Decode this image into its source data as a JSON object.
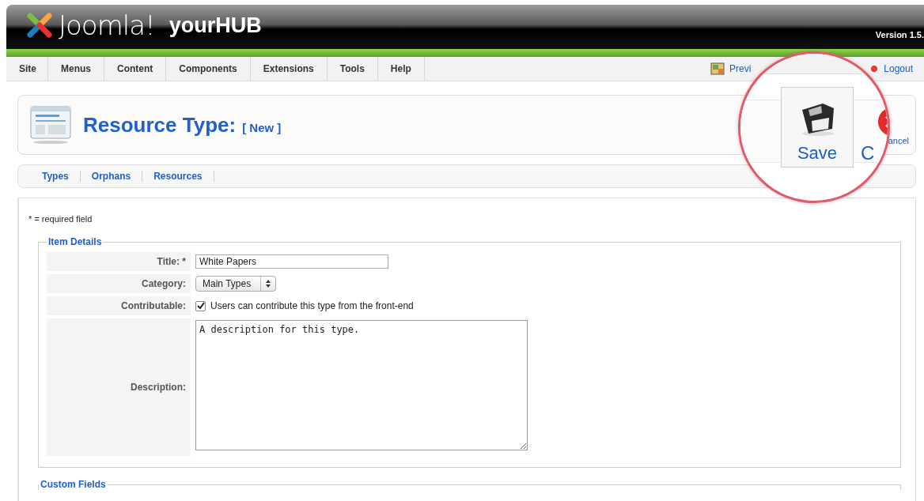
{
  "header": {
    "brand": "Joomla!",
    "site_name": "yourHUB",
    "version": "Version 1.5."
  },
  "menu": [
    {
      "label": "Site"
    },
    {
      "label": "Menus"
    },
    {
      "label": "Content"
    },
    {
      "label": "Components"
    },
    {
      "label": "Extensions"
    },
    {
      "label": "Tools"
    },
    {
      "label": "Help"
    }
  ],
  "header_links": [
    {
      "kind": "preview",
      "label": "Previ"
    },
    {
      "kind": "logout",
      "label": "Logout"
    }
  ],
  "toolbar": {
    "title": "Resource Type:",
    "subtitle": "[ New ]",
    "cancel_label": "ancel"
  },
  "magnifier": {
    "save_label": "Save",
    "cancel_label": "C"
  },
  "submenu": [
    {
      "label": "Types"
    },
    {
      "label": "Orphans"
    },
    {
      "label": "Resources"
    }
  ],
  "form": {
    "required_note": "* = required field",
    "fieldsets": [
      {
        "legend": "Item Details",
        "rows": [
          {
            "kind": "text",
            "label": "Title: *",
            "value": "White Papers"
          },
          {
            "kind": "select",
            "label": "Category:",
            "value": "Main Types"
          },
          {
            "kind": "checkbox",
            "label": "Contributable:",
            "checked": true,
            "text": "Users can contribute this type from the front-end"
          },
          {
            "kind": "textarea",
            "label": "Description:",
            "value": "A description for this type."
          }
        ]
      },
      {
        "legend": "Custom Fields"
      }
    ]
  }
}
